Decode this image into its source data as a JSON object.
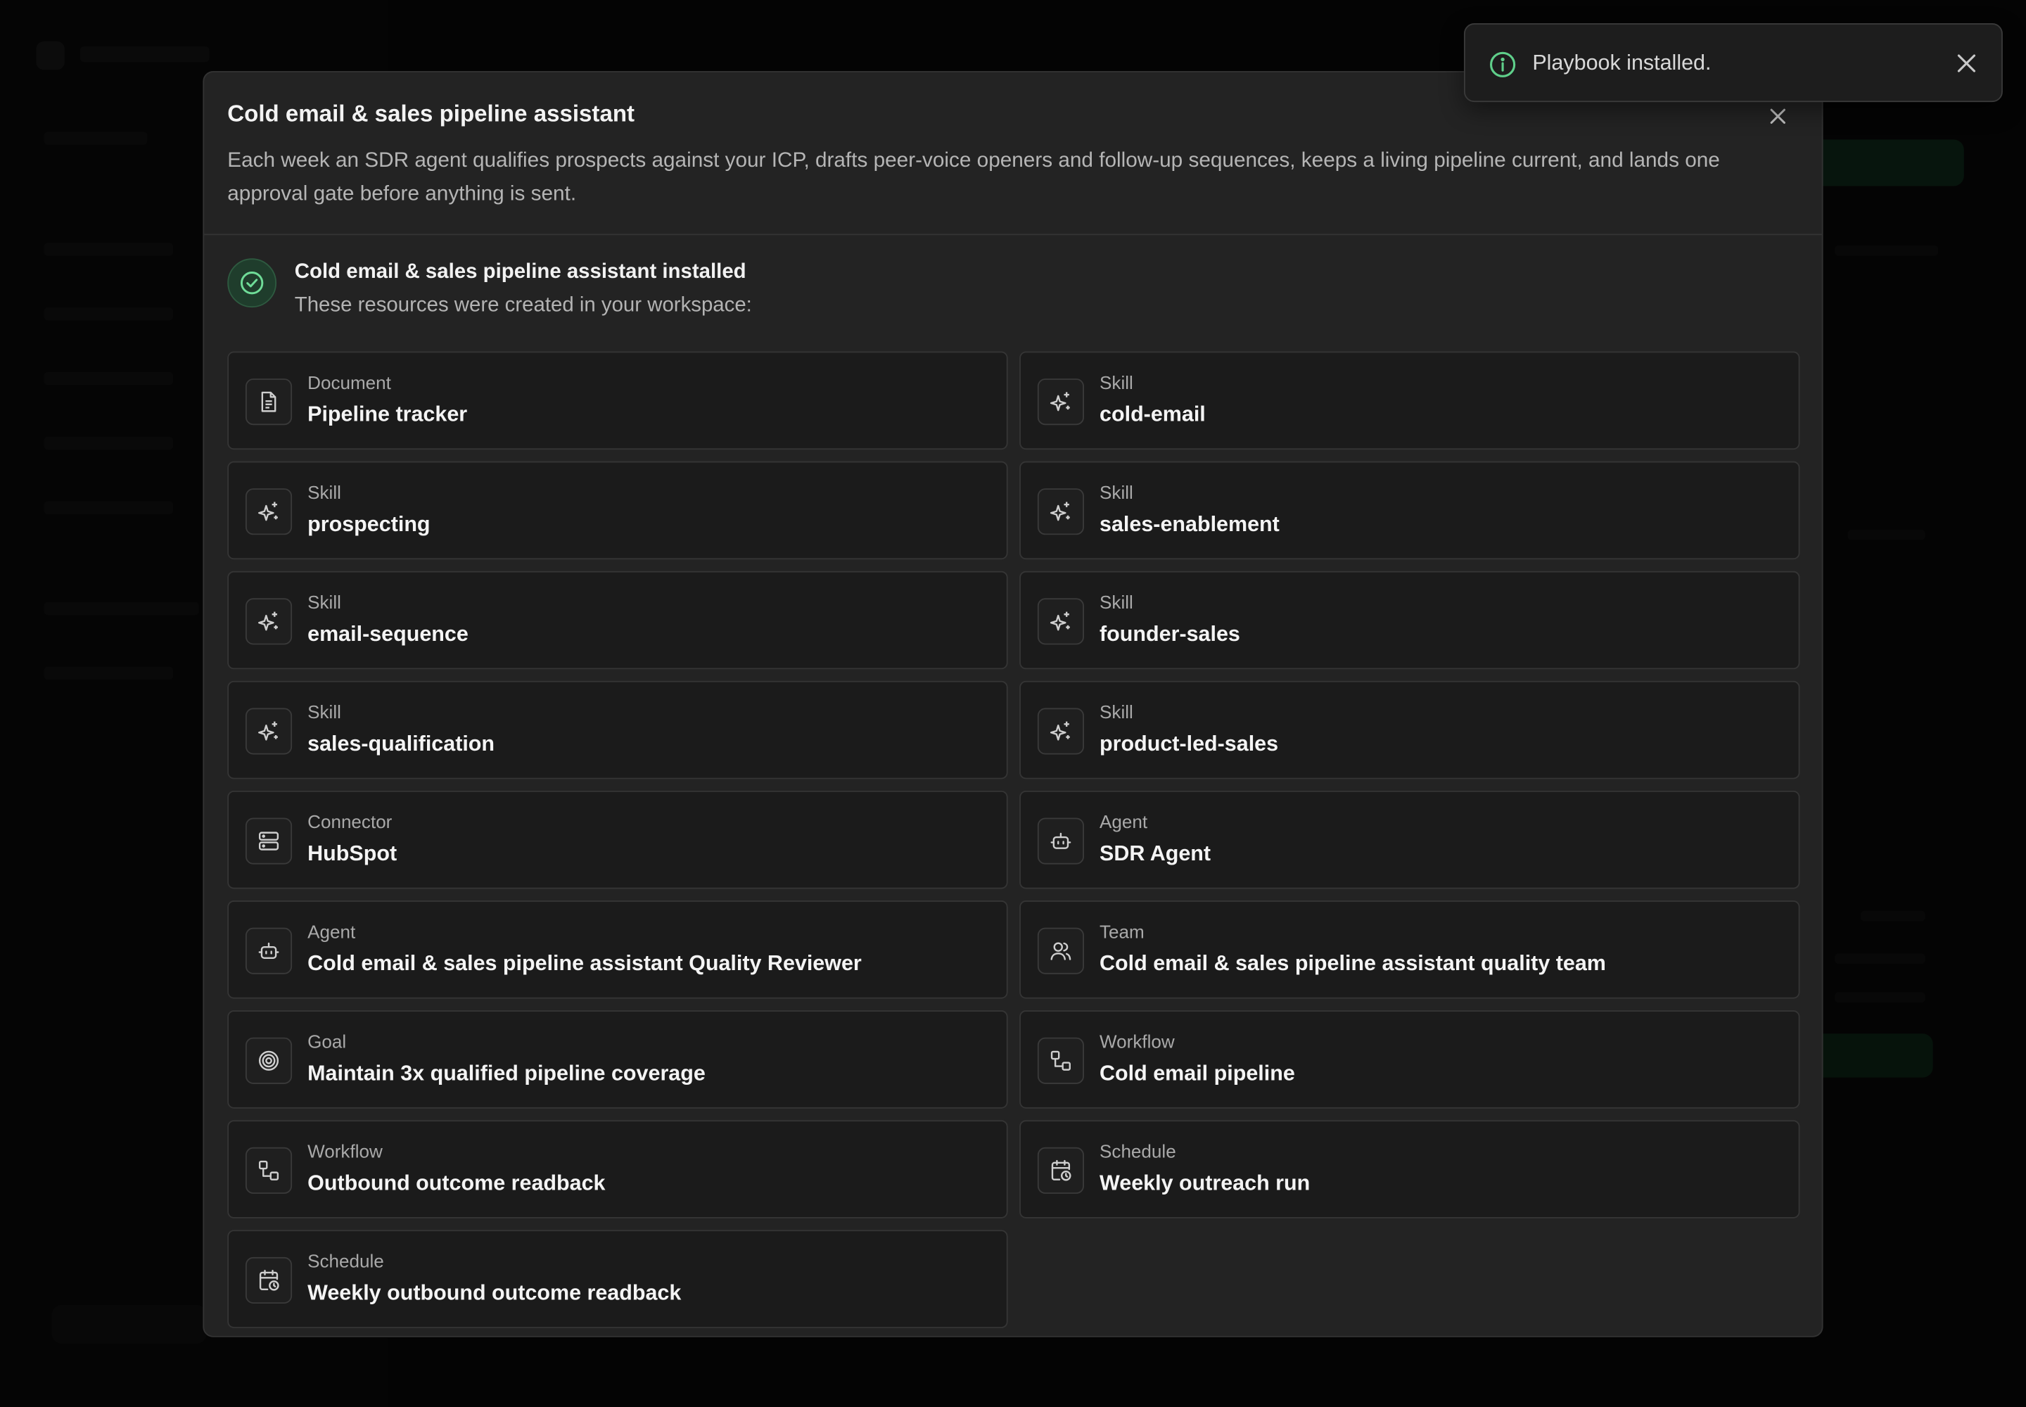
{
  "modal": {
    "title": "Cold email & sales pipeline assistant",
    "description": "Each week an SDR agent qualifies prospects against your ICP, drafts peer-voice openers and follow-up sequences, keeps a living pipeline current, and lands one approval gate before anything is sent.",
    "success_title": "Cold email & sales pipeline assistant installed",
    "success_subtitle": "These resources were created in your workspace:",
    "resources": [
      {
        "type": "Document",
        "name": "Pipeline tracker",
        "icon": "document-icon"
      },
      {
        "type": "Skill",
        "name": "cold-email",
        "icon": "sparkles-icon"
      },
      {
        "type": "Skill",
        "name": "prospecting",
        "icon": "sparkles-icon"
      },
      {
        "type": "Skill",
        "name": "sales-enablement",
        "icon": "sparkles-icon"
      },
      {
        "type": "Skill",
        "name": "email-sequence",
        "icon": "sparkles-icon"
      },
      {
        "type": "Skill",
        "name": "founder-sales",
        "icon": "sparkles-icon"
      },
      {
        "type": "Skill",
        "name": "sales-qualification",
        "icon": "sparkles-icon"
      },
      {
        "type": "Skill",
        "name": "product-led-sales",
        "icon": "sparkles-icon"
      },
      {
        "type": "Connector",
        "name": "HubSpot",
        "icon": "server-icon"
      },
      {
        "type": "Agent",
        "name": "SDR Agent",
        "icon": "bot-icon"
      },
      {
        "type": "Agent",
        "name": "Cold email & sales pipeline assistant Quality Reviewer",
        "icon": "bot-icon"
      },
      {
        "type": "Team",
        "name": "Cold email & sales pipeline assistant quality team",
        "icon": "users-icon"
      },
      {
        "type": "Goal",
        "name": "Maintain 3x qualified pipeline coverage",
        "icon": "target-icon"
      },
      {
        "type": "Workflow",
        "name": "Cold email pipeline",
        "icon": "workflow-icon"
      },
      {
        "type": "Workflow",
        "name": "Outbound outcome readback",
        "icon": "workflow-icon"
      },
      {
        "type": "Schedule",
        "name": "Weekly outreach run",
        "icon": "calendar-clock-icon"
      },
      {
        "type": "Schedule",
        "name": "Weekly outbound outcome readback",
        "icon": "calendar-clock-icon"
      }
    ]
  },
  "toast": {
    "message": "Playbook installed.",
    "icon": "info-icon"
  },
  "colors": {
    "accent_green": "#5fcf8a",
    "modal_bg": "#232323",
    "card_bg": "#1b1b1b"
  }
}
